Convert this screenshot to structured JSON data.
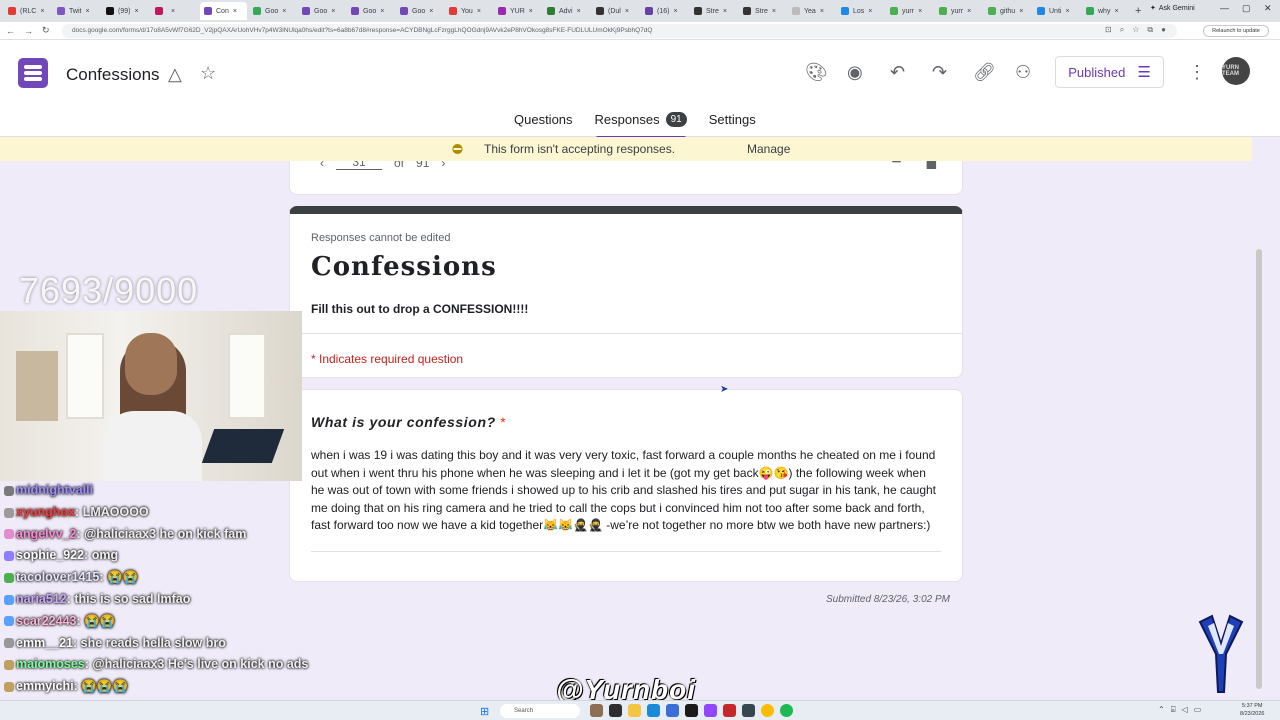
{
  "browser": {
    "tabs": [
      {
        "label": "(RLC",
        "color": "#e53935",
        "active": false
      },
      {
        "label": "Twit",
        "color": "#7e57c2",
        "active": false
      },
      {
        "label": "(99)",
        "color": "#111111",
        "active": false
      },
      {
        "label": "",
        "color": "#c2185b",
        "active": false
      },
      {
        "label": "Con",
        "color": "#7248b9",
        "active": true
      },
      {
        "label": "Goo",
        "color": "#34a853",
        "active": false
      },
      {
        "label": "Goo",
        "color": "#7248b9",
        "active": false
      },
      {
        "label": "Goo",
        "color": "#7248b9",
        "active": false
      },
      {
        "label": "Goo",
        "color": "#7248b9",
        "active": false
      },
      {
        "label": "You",
        "color": "#e53935",
        "active": false
      },
      {
        "label": "YUR",
        "color": "#9c27b0",
        "active": false
      },
      {
        "label": "Advi",
        "color": "#2e7d32",
        "active": false
      },
      {
        "label": "(Dul",
        "color": "#333333",
        "active": false
      },
      {
        "label": "(16)",
        "color": "#6441a5",
        "active": false
      },
      {
        "label": "Stre",
        "color": "#333333",
        "active": false
      },
      {
        "label": "Stre",
        "color": "#333333",
        "active": false
      },
      {
        "label": "Yea",
        "color": "#bbbbbb",
        "active": false
      },
      {
        "label": "Los",
        "color": "#1e88e5",
        "active": false
      },
      {
        "label": "yurr",
        "color": "#4caf50",
        "active": false
      },
      {
        "label": "yurr",
        "color": "#4caf50",
        "active": false
      },
      {
        "label": "githu",
        "color": "#4caf50",
        "active": false
      },
      {
        "label": "Unti",
        "color": "#1e88e5",
        "active": false
      },
      {
        "label": "why",
        "color": "#34a853",
        "active": false
      }
    ],
    "new_tab": "+",
    "ask_gemini": "Ask Gemini",
    "url": "docs.google.com/forms/d/17o8A5vWf7G62D_V2jpQAXArUohVHv7p4W3lNUlqa0hs/edit?ts=6a8b67d8#response=ACYDBNgLcFzrggLhQOGdnj9AVvk2eP8hVOkosg8sFKE-FUDLULUmOkKj9PsbhQ7dQ",
    "relaunch": "Relaunch to update"
  },
  "header": {
    "title": "Confessions",
    "publish_label": "Published",
    "avatar_text": "YURN TEAM",
    "tabs": {
      "questions": "Questions",
      "responses": "Responses",
      "responses_count": "91",
      "settings": "Settings"
    }
  },
  "notice": {
    "text": "This form isn't accepting responses.",
    "manage": "Manage"
  },
  "pager": {
    "current": "31",
    "of": "of",
    "total": "91"
  },
  "form": {
    "cannot_edit": "Responses cannot be edited",
    "heading": "Confessions",
    "description": "Fill this out to drop a CONFESSION!!!!",
    "required_note": "* Indicates required question",
    "question": "What is your confession?",
    "question_star": "*",
    "answer": "when i was 19 i was dating this boy and it was very very toxic, fast forward a couple months he cheated on me i found out when i went thru his phone when he was sleeping and i let it be (got my get back😜😘) the following week when he was out of town with some friends i showed up to his crib and slashed his tires and put sugar in his tank, he caught me doing that on his ring camera and he tried to call the cops but i convinced him not too after some back and forth, fast forward too now we have a kid together😹😹🥷🥷 -we’re not together no more btw we both have new partners:)",
    "submitted": "Submitted 8/23/26, 3:02 PM"
  },
  "stream": {
    "viewer_count": "7693/9000",
    "watermark": "@Yurnboi",
    "chat": [
      {
        "user": "midnightvalli",
        "msg": "",
        "color": "#9b8cff",
        "badge": "#7a7a7a"
      },
      {
        "user": "xyunghox",
        "msg": "LMAOOOO",
        "color": "#ff3b3b",
        "badge": "#9b9b9b"
      },
      {
        "user": "angelvv_2",
        "msg": "@haliciaax3 he on kick fam",
        "color": "#ff8ad8",
        "badge": "#e38ccf"
      },
      {
        "user": "sophie_922",
        "msg": "omg",
        "color": "#ffffff",
        "badge": "#8e7dff"
      },
      {
        "user": "tacolover1415",
        "msg": "😭😭",
        "color": "#e6e6ff",
        "badge": "#4caf50"
      },
      {
        "user": "naria512",
        "msg": "this is so sad lmfao",
        "color": "#c9a7ff",
        "badge": "#5aa0ff"
      },
      {
        "user": "scar22443",
        "msg": "😭😭",
        "color": "#ffb3d9",
        "badge": "#5aa0ff"
      },
      {
        "user": "emm__21",
        "msg": "she reads hella slow bro",
        "color": "#ffffff",
        "badge": "#999999"
      },
      {
        "user": "maiomoses",
        "msg": "@haliciaax3 He's live on kick no ads",
        "color": "#7bff9c",
        "badge": "#c0a060"
      },
      {
        "user": "emmyichi",
        "msg": "😭😭😭",
        "color": "#ffffff",
        "badge": "#c0a060"
      }
    ]
  },
  "taskbar": {
    "search": "Search",
    "time": "5:37 PM",
    "date": "8/23/2026"
  }
}
